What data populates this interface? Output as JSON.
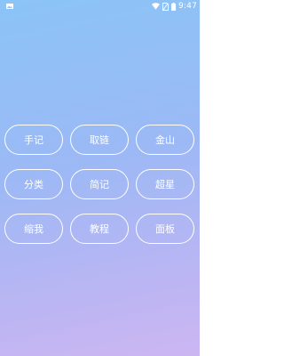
{
  "status_bar": {
    "time": "9:47",
    "left_icon": "image-thumbnail-icon",
    "right_icons": [
      "wifi-icon",
      "no-sim-icon",
      "battery-icon"
    ]
  },
  "buttons": [
    {
      "label": "手记"
    },
    {
      "label": "取链"
    },
    {
      "label": "金山"
    },
    {
      "label": "分类"
    },
    {
      "label": "简记"
    },
    {
      "label": "超星"
    },
    {
      "label": "缩我"
    },
    {
      "label": "教程"
    },
    {
      "label": "面板"
    }
  ],
  "colors": {
    "gradient_top": "#8bc4f6",
    "gradient_bottom": "#ccb6f2",
    "button_border": "#ffffff",
    "button_text": "#ffffff"
  }
}
